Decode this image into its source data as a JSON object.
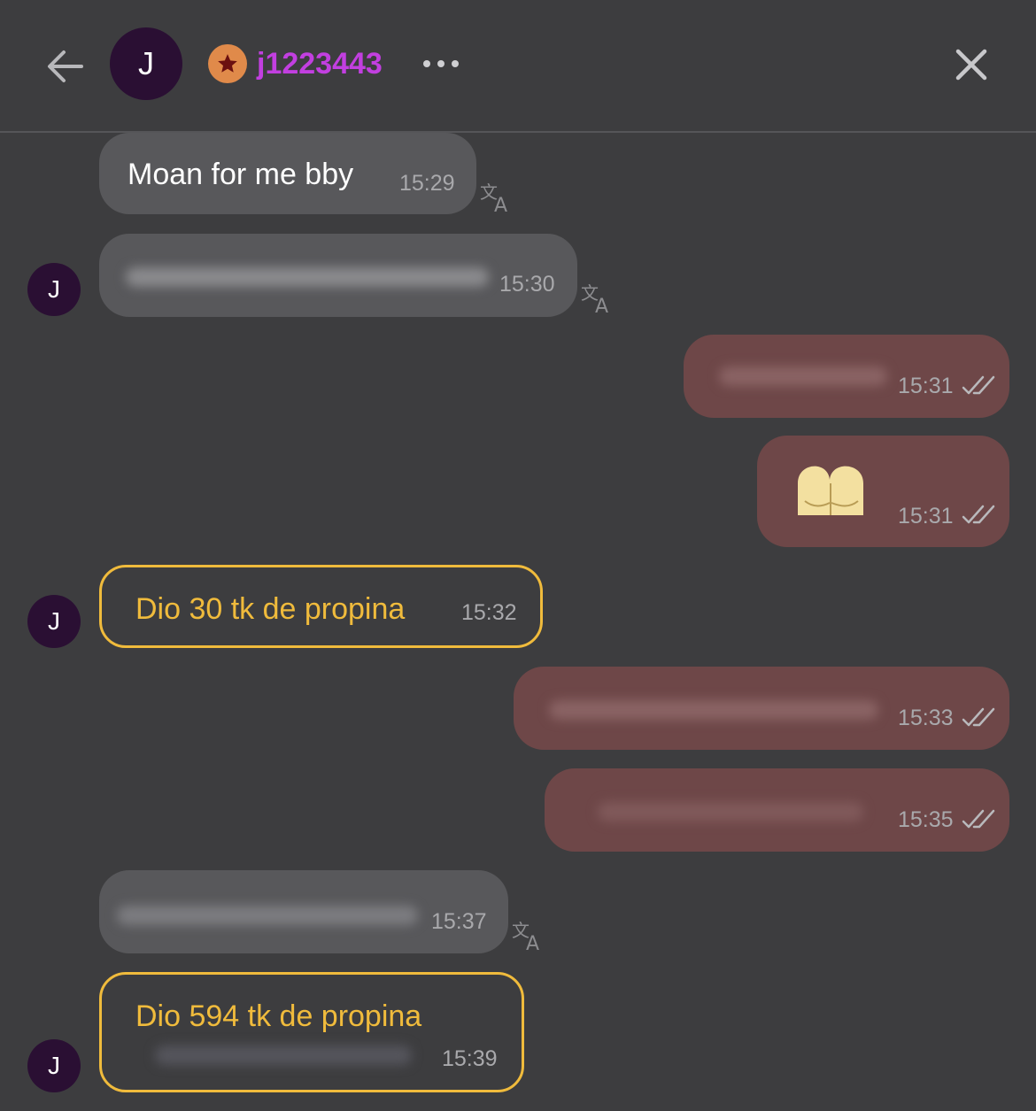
{
  "header": {
    "avatar_initial": "J",
    "username": "j1223443",
    "username_color": "#c23fe0",
    "badge_color": "#e08a4a",
    "icons": [
      "back-arrow-icon",
      "star-badge-icon",
      "more-dots-icon",
      "close-icon"
    ]
  },
  "messages": [
    {
      "type": "incoming",
      "text": "Moan for me bby",
      "time": "15:29"
    },
    {
      "type": "incoming",
      "text": "",
      "time": "15:30",
      "redacted": true
    },
    {
      "type": "outgoing",
      "text": "",
      "time": "15:31",
      "redacted": true,
      "read": true
    },
    {
      "type": "outgoing",
      "emoji": "peach-bottom-emoji",
      "time": "15:31",
      "read": true
    },
    {
      "type": "tip",
      "text": "Dio 30 tk de propina",
      "time": "15:32"
    },
    {
      "type": "outgoing",
      "text": "",
      "time": "15:33",
      "redacted": true,
      "read": true
    },
    {
      "type": "outgoing",
      "text": "",
      "time": "15:35",
      "redacted": true,
      "read": true
    },
    {
      "type": "incoming",
      "text": "",
      "time": "15:37",
      "redacted": true
    },
    {
      "type": "tip",
      "text": "Dio 594 tk de propina",
      "time": "15:39"
    }
  ],
  "sender_initial": "J",
  "colors": {
    "background": "#3d3d3f",
    "incoming_bubble": "#58585b",
    "outgoing_bubble": "#6e4748",
    "tip_accent": "#f0bb3c"
  }
}
